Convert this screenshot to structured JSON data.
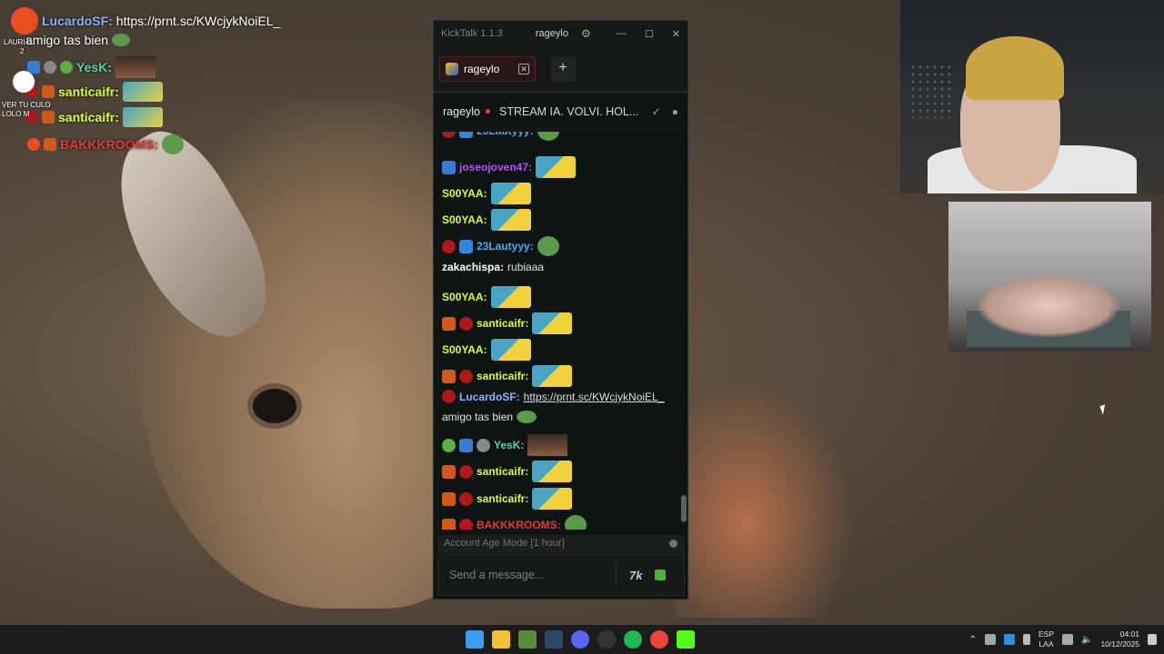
{
  "overlay": {
    "rows": [
      {
        "user": "LucardoSF:",
        "text": "https://prnt.sc/KWcjykNoiEL_",
        "user_color": "#8ab4ff"
      },
      {
        "text": "amigo tas bien"
      },
      {
        "user": "YesK:",
        "user_color": "#5fd0a8"
      },
      {
        "user": "santicaifr:",
        "user_color": "#d6ff3a"
      },
      {
        "user": "santicaifr:",
        "user_color": "#d6ff3a"
      },
      {
        "user": "BAKKKROOMS:",
        "user_color": "#e53935"
      }
    ],
    "side_labels": [
      "LAURI L",
      "2",
      "VER TU CULO",
      "LOLO M"
    ]
  },
  "app": {
    "name": "KickTalk 1.1.3",
    "channel": "rageylo",
    "window_controls": [
      "—",
      "☐",
      "✕"
    ],
    "gear_icon": "⚙"
  },
  "tabs": [
    {
      "label": "rageylo",
      "close": "✕"
    }
  ],
  "add_tab": "+",
  "channel_header": {
    "name": "rageylo",
    "stream_title": "STREAM IA. VOLVI. HOL...",
    "live_color": "#e53935"
  },
  "messages": [
    {
      "user": "23Lautyyy:",
      "color": "#3fa9ff",
      "badges": [
        "mod",
        "gift"
      ],
      "emote": "pepe",
      "partial": true
    },
    {
      "user": "joseojoven47:",
      "color": "#b94dff",
      "badges": [
        "blue"
      ],
      "emote": "yellow"
    },
    {
      "user": "S00YAA:",
      "color": "#d6ff3a",
      "badges": [],
      "emote": "yellow"
    },
    {
      "user": "S00YAA:",
      "color": "#d6ff3a",
      "badges": [],
      "emote": "yellow"
    },
    {
      "user": "23Lautyyy:",
      "color": "#3fa9ff",
      "badges": [
        "mod",
        "gift"
      ],
      "emote": "pepe"
    },
    {
      "user": "zakachispa:",
      "color": "#ffffff",
      "badges": [],
      "text": "rubiaaa"
    },
    {
      "user": "S00YAA:",
      "color": "#d6ff3a",
      "badges": [],
      "emote": "yellow"
    },
    {
      "user": "santicaifr:",
      "color": "#d6ff3a",
      "badges": [
        "sub",
        "mod"
      ],
      "emote": "yellow"
    },
    {
      "user": "S00YAA:",
      "color": "#d6ff3a",
      "badges": [],
      "emote": "yellow"
    },
    {
      "user": "santicaifr:",
      "color": "#d6ff3a",
      "badges": [
        "sub",
        "mod"
      ],
      "emote": "yellow"
    },
    {
      "user": "LucardoSF:",
      "color": "#8ab4ff",
      "badges": [
        "red"
      ],
      "link": "https://prnt.sc/KWcjykNoiEL_",
      "text2": "amigo tas bien"
    },
    {
      "user": "YesK:",
      "color": "#5fd0a8",
      "badges": [
        "green",
        "blue",
        "gray"
      ],
      "emote": "face"
    },
    {
      "user": "santicaifr:",
      "color": "#d6ff3a",
      "badges": [
        "sub",
        "mod"
      ],
      "emote": "yellow"
    },
    {
      "user": "santicaifr:",
      "color": "#d6ff3a",
      "badges": [
        "sub",
        "mod"
      ],
      "emote": "yellow"
    },
    {
      "user": "BAKKKROOMS:",
      "color": "#e53935",
      "badges": [
        "sub",
        "red"
      ],
      "emote": "pepe"
    }
  ],
  "input": {
    "mode_notice": "Account Age Mode [1 hour]",
    "placeholder": "Send a message...",
    "kick_emote_label": "7k"
  },
  "taskbar": {
    "apps": [
      "windows-start",
      "file-explorer",
      "minecraft",
      "steam",
      "discord",
      "obs",
      "spotify",
      "chrome",
      "kick"
    ],
    "language": "ESP",
    "language2": "LAA",
    "time": "04:01",
    "date": "10/12/2025"
  }
}
